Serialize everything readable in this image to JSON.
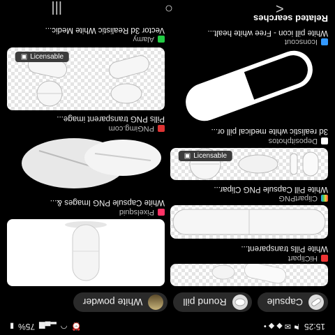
{
  "status_bar": {
    "time": "15:25",
    "battery": "75%"
  },
  "chips": [
    {
      "label": "Capsule"
    },
    {
      "label": "Round pill"
    },
    {
      "label": "White powder"
    }
  ],
  "left_column": [
    {
      "source": "HiClipart",
      "title": "White Pills transparent..."
    },
    {
      "source": "ClipartPNG",
      "title": "White Pill Capsule PNG Clipar...",
      "badge": "Licensable"
    },
    {
      "source": "Depositphotos",
      "title": "3d realistic white medical pill or..."
    },
    {
      "source": "Iconscout",
      "title": "White pill icon - Free white healt..."
    }
  ],
  "right_column": [
    {
      "source": "Pixelsquid",
      "title": "White Capsule PNG Images &..."
    },
    {
      "source": "PNGimg.com",
      "title": "Pills PNG transparent image..."
    },
    {
      "source": "Alamy",
      "title": "Vector 3d Realistic White Medic...",
      "badge": "Licensable"
    }
  ],
  "related_heading": "Related searches",
  "nav": {
    "back": "<",
    "home": "○",
    "recents": "|||"
  }
}
